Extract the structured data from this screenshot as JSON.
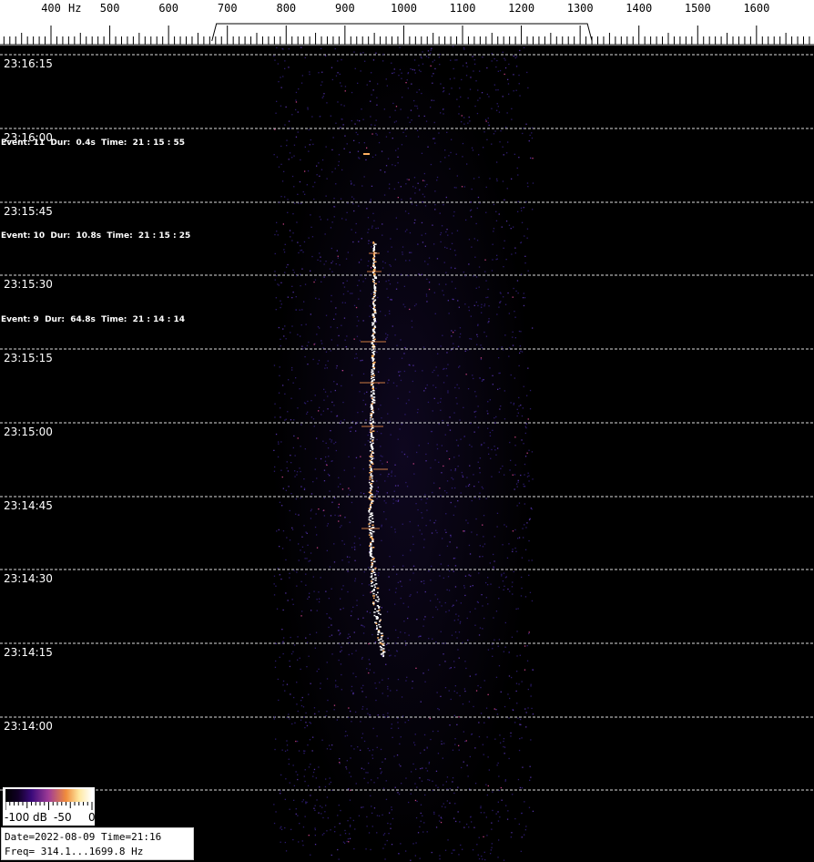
{
  "header": {
    "freq_ticks": [
      {
        "label": "400",
        "hz": 400
      },
      {
        "label": "500",
        "hz": 500
      },
      {
        "label": "600",
        "hz": 600
      },
      {
        "label": "700",
        "hz": 700
      },
      {
        "label": "800",
        "hz": 800
      },
      {
        "label": "900",
        "hz": 900
      },
      {
        "label": "1000",
        "hz": 1000
      },
      {
        "label": "1100",
        "hz": 1100
      },
      {
        "label": "1200",
        "hz": 1200
      },
      {
        "label": "1300",
        "hz": 1300
      },
      {
        "label": "1400",
        "hz": 1400
      },
      {
        "label": "1500",
        "hz": 1500
      },
      {
        "label": "1600",
        "hz": 1600
      }
    ],
    "unit": "Hz",
    "filter_range_hz": [
      700,
      1300
    ]
  },
  "time_labels": [
    "23:16:15",
    "23:16:00",
    "23:15:45",
    "23:15:30",
    "23:15:15",
    "23:15:00",
    "23:14:45",
    "23:14:30",
    "23:14:15",
    "23:14:00"
  ],
  "events": [
    {
      "text": "Event: 11  Dur:  0.4s  Time:  21 : 15 : 55"
    },
    {
      "text": "Event: 10  Dur:  10.8s  Time:  21 : 15 : 25"
    },
    {
      "text": "Event: 9  Dur:  64.8s  Time:  21 : 14 : 14"
    }
  ],
  "legend": {
    "label_min": "-100 dB",
    "label_mid": "-50",
    "label_max": "0"
  },
  "info": {
    "line1": "Date=2022-08-09 Time=21:16",
    "line2": "Freq= 314.1...1699.8 Hz"
  },
  "colors": {
    "background": "#000000",
    "trace_core": "#ffffff",
    "trace_glow": "#ffb060",
    "noise": "#2a1a6a"
  }
}
